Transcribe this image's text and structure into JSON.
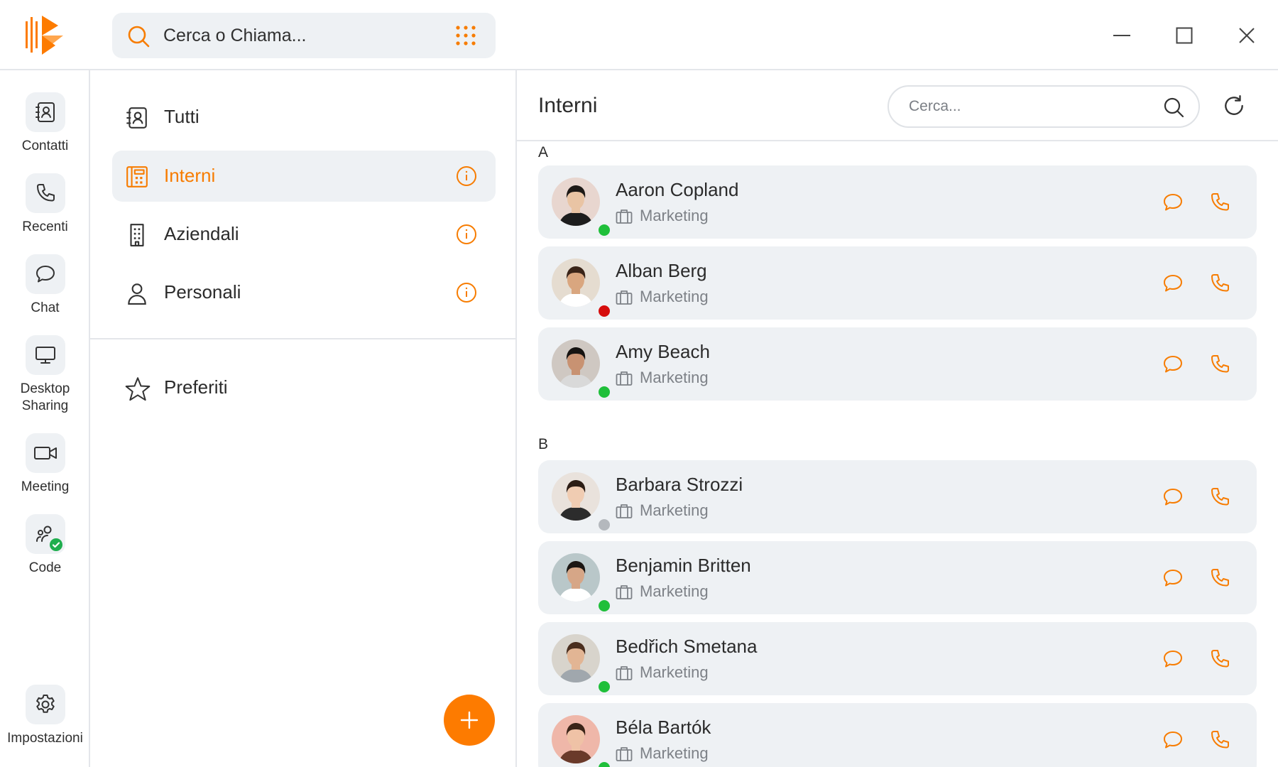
{
  "header": {
    "search_placeholder": "Cerca o Chiama...",
    "logo_icon": "brand-logo",
    "dialpad_icon": "dialpad-icon"
  },
  "rail": {
    "items": [
      {
        "label": "Contatti",
        "icon": "contacts-book-icon"
      },
      {
        "label": "Recenti",
        "icon": "phone-icon"
      },
      {
        "label": "Chat",
        "icon": "chat-bubble-icon"
      },
      {
        "label": "Desktop Sharing",
        "icon": "monitor-icon"
      },
      {
        "label": "Meeting",
        "icon": "video-camera-icon"
      },
      {
        "label": "Code",
        "icon": "queue-users-icon"
      }
    ],
    "settings": {
      "label": "Impostazioni",
      "icon": "gear-icon"
    }
  },
  "categories": {
    "items": [
      {
        "label": "Tutti",
        "icon": "contacts-book-icon",
        "active": false,
        "info": false
      },
      {
        "label": "Interni",
        "icon": "calculator-building-icon",
        "active": true,
        "info": true
      },
      {
        "label": "Aziendali",
        "icon": "building-icon",
        "active": false,
        "info": true
      },
      {
        "label": "Personali",
        "icon": "person-icon",
        "active": false,
        "info": true
      }
    ],
    "favorites": {
      "label": "Preferiti",
      "icon": "star-icon"
    },
    "add_icon": "plus-icon"
  },
  "contacts": {
    "title": "Interni",
    "search_placeholder": "Cerca...",
    "groups": [
      {
        "letter": "A",
        "items": [
          {
            "name": "Aaron Copland",
            "department": "Marketing",
            "status": "online"
          },
          {
            "name": "Alban Berg",
            "department": "Marketing",
            "status": "busy"
          },
          {
            "name": "Amy Beach",
            "department": "Marketing",
            "status": "online"
          }
        ]
      },
      {
        "letter": "B",
        "items": [
          {
            "name": "Barbara Strozzi",
            "department": "Marketing",
            "status": "offline"
          },
          {
            "name": "Benjamin Britten",
            "department": "Marketing",
            "status": "online"
          },
          {
            "name": "Bedřich Smetana",
            "department": "Marketing",
            "status": "online"
          },
          {
            "name": "Béla Bartók",
            "department": "Marketing",
            "status": "online"
          }
        ]
      }
    ]
  },
  "colors": {
    "accent": "#fd7b00",
    "panel_bg": "#eef1f4",
    "status_online": "#1fbf3a",
    "status_busy": "#d60d0d",
    "status_offline": "#b4b8bd"
  }
}
